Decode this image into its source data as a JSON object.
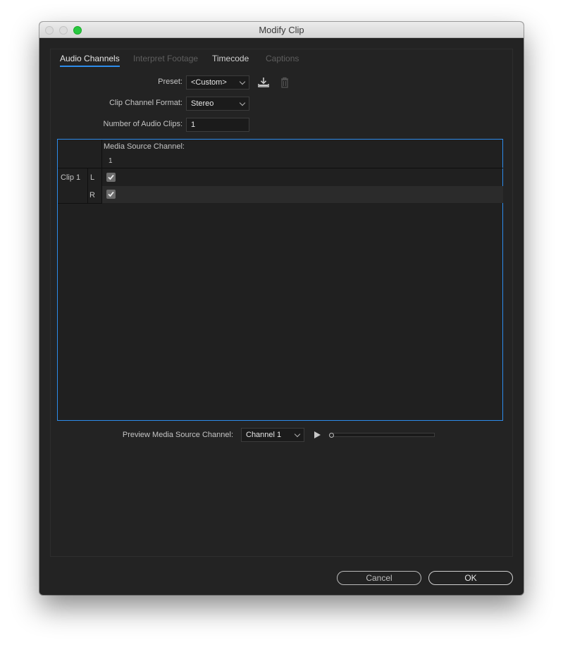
{
  "window": {
    "title": "Modify Clip"
  },
  "tabs": [
    {
      "label": "Audio Channels",
      "state": "active"
    },
    {
      "label": "Interpret Footage",
      "state": "disabled"
    },
    {
      "label": "Timecode",
      "state": "normal"
    },
    {
      "label": "Captions",
      "state": "disabled"
    }
  ],
  "form": {
    "preset_label": "Preset:",
    "preset_value": "<Custom>",
    "format_label": "Clip Channel Format:",
    "format_value": "Stereo",
    "num_clips_label": "Number of Audio Clips:",
    "num_clips_value": "1"
  },
  "icons": {
    "save_preset": "download-icon",
    "delete_preset": "trash-icon",
    "play": "play-icon"
  },
  "grid": {
    "header": "Media Source Channel:",
    "column": "1",
    "clip_label": "Clip 1",
    "rows": [
      {
        "channel": "L",
        "checked": true
      },
      {
        "channel": "R",
        "checked": true
      }
    ]
  },
  "preview": {
    "label": "Preview Media Source Channel:",
    "value": "Channel 1",
    "progress": 0
  },
  "buttons": {
    "cancel": "Cancel",
    "ok": "OK"
  },
  "colors": {
    "accent": "#2d8ceb",
    "window_bg": "#232323",
    "close_green": "#28c840"
  }
}
